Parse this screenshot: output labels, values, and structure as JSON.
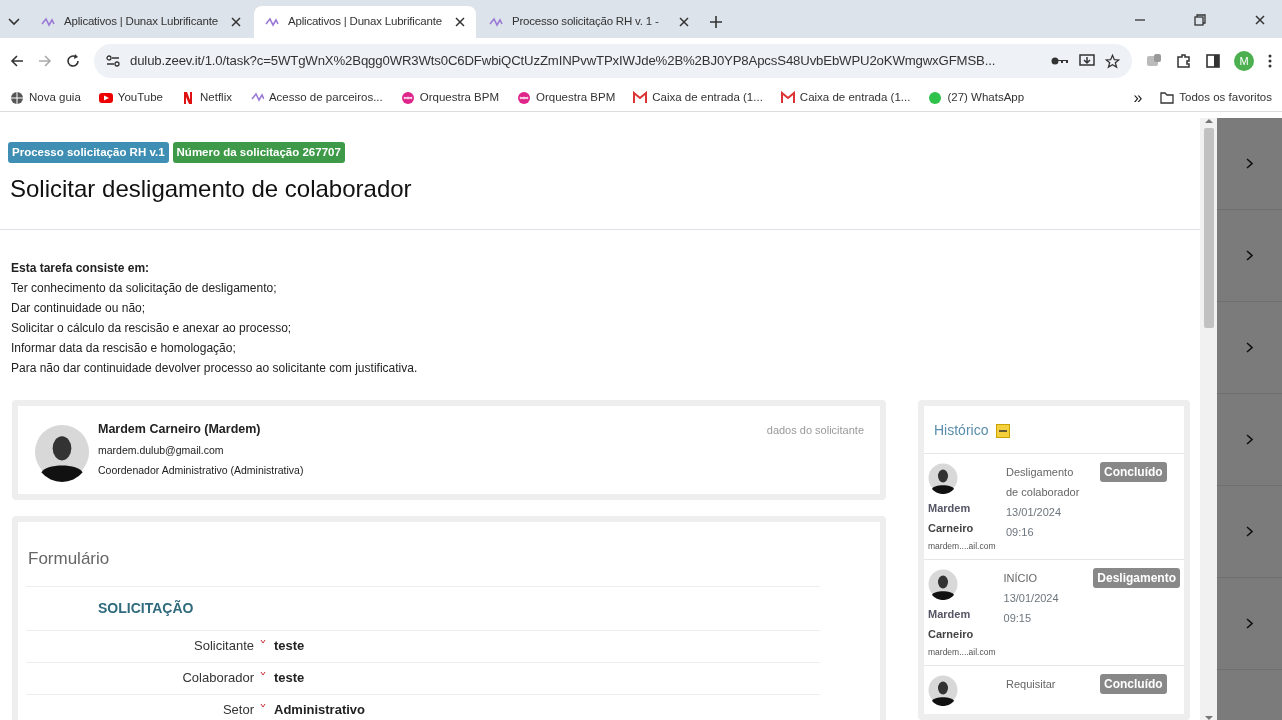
{
  "tabs": [
    {
      "title": "Aplicativos | Dunax Lubrificante",
      "selected": false
    },
    {
      "title": "Aplicativos | Dunax Lubrificante",
      "selected": true
    },
    {
      "title": "Processo solicitação RH v. 1 -",
      "selected": false
    }
  ],
  "address": {
    "url": "dulub.zeev.it/1.0/task?c=5WTgWnX%2Bqgg0WR3Wts0C6DFwbiQCtUzZmINPvwTPxIWJde%2B%2BJ0YP8ApcsS48UvbEbWPU2oKWmgwxGFMSB..."
  },
  "profile": {
    "initial": "M"
  },
  "bookmarks": [
    {
      "label": "Nova guia"
    },
    {
      "label": "YouTube"
    },
    {
      "label": "Netflix"
    },
    {
      "label": "Acesso de parceiros..."
    },
    {
      "label": "Orquestra BPM"
    },
    {
      "label": "Orquestra BPM"
    },
    {
      "label": "Caixa de entrada (1..."
    },
    {
      "label": "Caixa de entrada (1..."
    },
    {
      "label": "(27) WhatsApp"
    }
  ],
  "bookmarks_more": "»",
  "all_bookmarks": "Todos os favoritos",
  "badges": [
    {
      "text": "Processo solicitação RH v.1",
      "color": "#3f8fb4"
    },
    {
      "text": "Número da solicitação 267707",
      "color": "#3e9a48"
    }
  ],
  "title": "Solicitar desligamento de colaborador",
  "task": {
    "heading": "Esta tarefa consiste em:",
    "lines": [
      "Ter conhecimento da solicitação de desligamento;",
      "Dar continuidade ou não;",
      "Solicitar o cálculo da rescisão e anexar ao processo;",
      "Informar data da rescisão e homologação;",
      "Para não dar continuidade devolver processo ao solicitante com justificativa."
    ]
  },
  "requester": {
    "name": "Mardem Carneiro (Mardem)",
    "email": "mardem.dulub@gmail.com",
    "role": "Coordenador Administrativo (Administrativa)",
    "caption": "dados do solicitante"
  },
  "form": {
    "title": "Formulário",
    "section": "SOLICITAÇÃO",
    "fields": [
      {
        "label": "Solicitante",
        "required": true,
        "value": "teste"
      },
      {
        "label": "Colaborador",
        "required": true,
        "value": "teste"
      },
      {
        "label": "Setor",
        "required": true,
        "value": "Administrativo"
      }
    ]
  },
  "history": {
    "title": "Histórico",
    "entries": [
      {
        "first_name": "Mardem",
        "last_name": "Carneiro",
        "email": "mardem....ail.com",
        "activity": [
          "Desligamento",
          "de colaborador"
        ],
        "date": "13/01/2024",
        "time": "09:16",
        "status": "Concluído"
      },
      {
        "first_name": "Mardem",
        "last_name": "Carneiro",
        "email": "mardem....ail.com",
        "activity": [
          "INÍCIO"
        ],
        "date": "13/01/2024",
        "time": "09:15",
        "status": "Desligamento"
      },
      {
        "activity": [
          "Requisitar"
        ],
        "status": "Concluído"
      }
    ]
  }
}
